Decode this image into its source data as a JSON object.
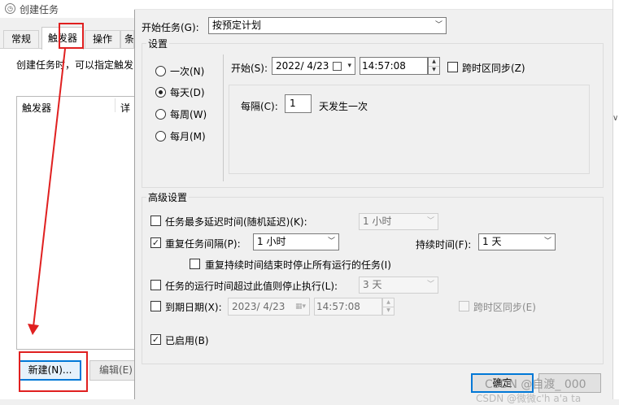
{
  "background_window": {
    "title": "创建任务",
    "tabs": [
      "常规",
      "触发器",
      "操作",
      "条"
    ],
    "description": "创建任务时，可以指定触发",
    "list_columns": [
      "触发器",
      "详"
    ],
    "new_button": "新建(N)...",
    "edit_button": "编辑(E)"
  },
  "dialog": {
    "begin_task_label": "开始任务(G):",
    "begin_task_value": "按预定计划",
    "settings_title": "设置",
    "schedule_options": [
      "一次(N)",
      "每天(D)",
      "每周(W)",
      "每月(M)"
    ],
    "selected_schedule": "每天(D)",
    "start_label": "开始(S):",
    "start_date": "2022/ 4/23",
    "start_time": "14:57:08",
    "sync_timezone_label": "跨时区同步(Z)",
    "every_label": "每隔(C):",
    "every_value": "1",
    "every_suffix": "天发生一次",
    "advanced_title": "高级设置",
    "delay_label": "任务最多延迟时间(随机延迟)(K):",
    "delay_value": "1 小时",
    "repeat_label": "重复任务间隔(P):",
    "repeat_value": "1 小时",
    "duration_label": "持续时间(F):",
    "duration_value": "1 天",
    "stop_all_label": "重复持续时间结束时停止所有运行的任务(I)",
    "stop_longer_label": "任务的运行时间超过此值则停止执行(L):",
    "stop_longer_value": "3 天",
    "expire_label": "到期日期(X):",
    "expire_date": "2023/ 4/23",
    "expire_time": "14:57:08",
    "expire_sync_label": "跨时区同步(E)",
    "enabled_label": "已启用(B)",
    "ok_button": "确定",
    "watermark": "CSDN @自渡_ 000",
    "watermark2": "CSDN @微微c'h a'a ta"
  },
  "state": {
    "repeat_checked": true,
    "enabled_checked": true
  },
  "colors": {
    "annotation_red": "#e02020",
    "focus_blue": "#0078d7"
  }
}
